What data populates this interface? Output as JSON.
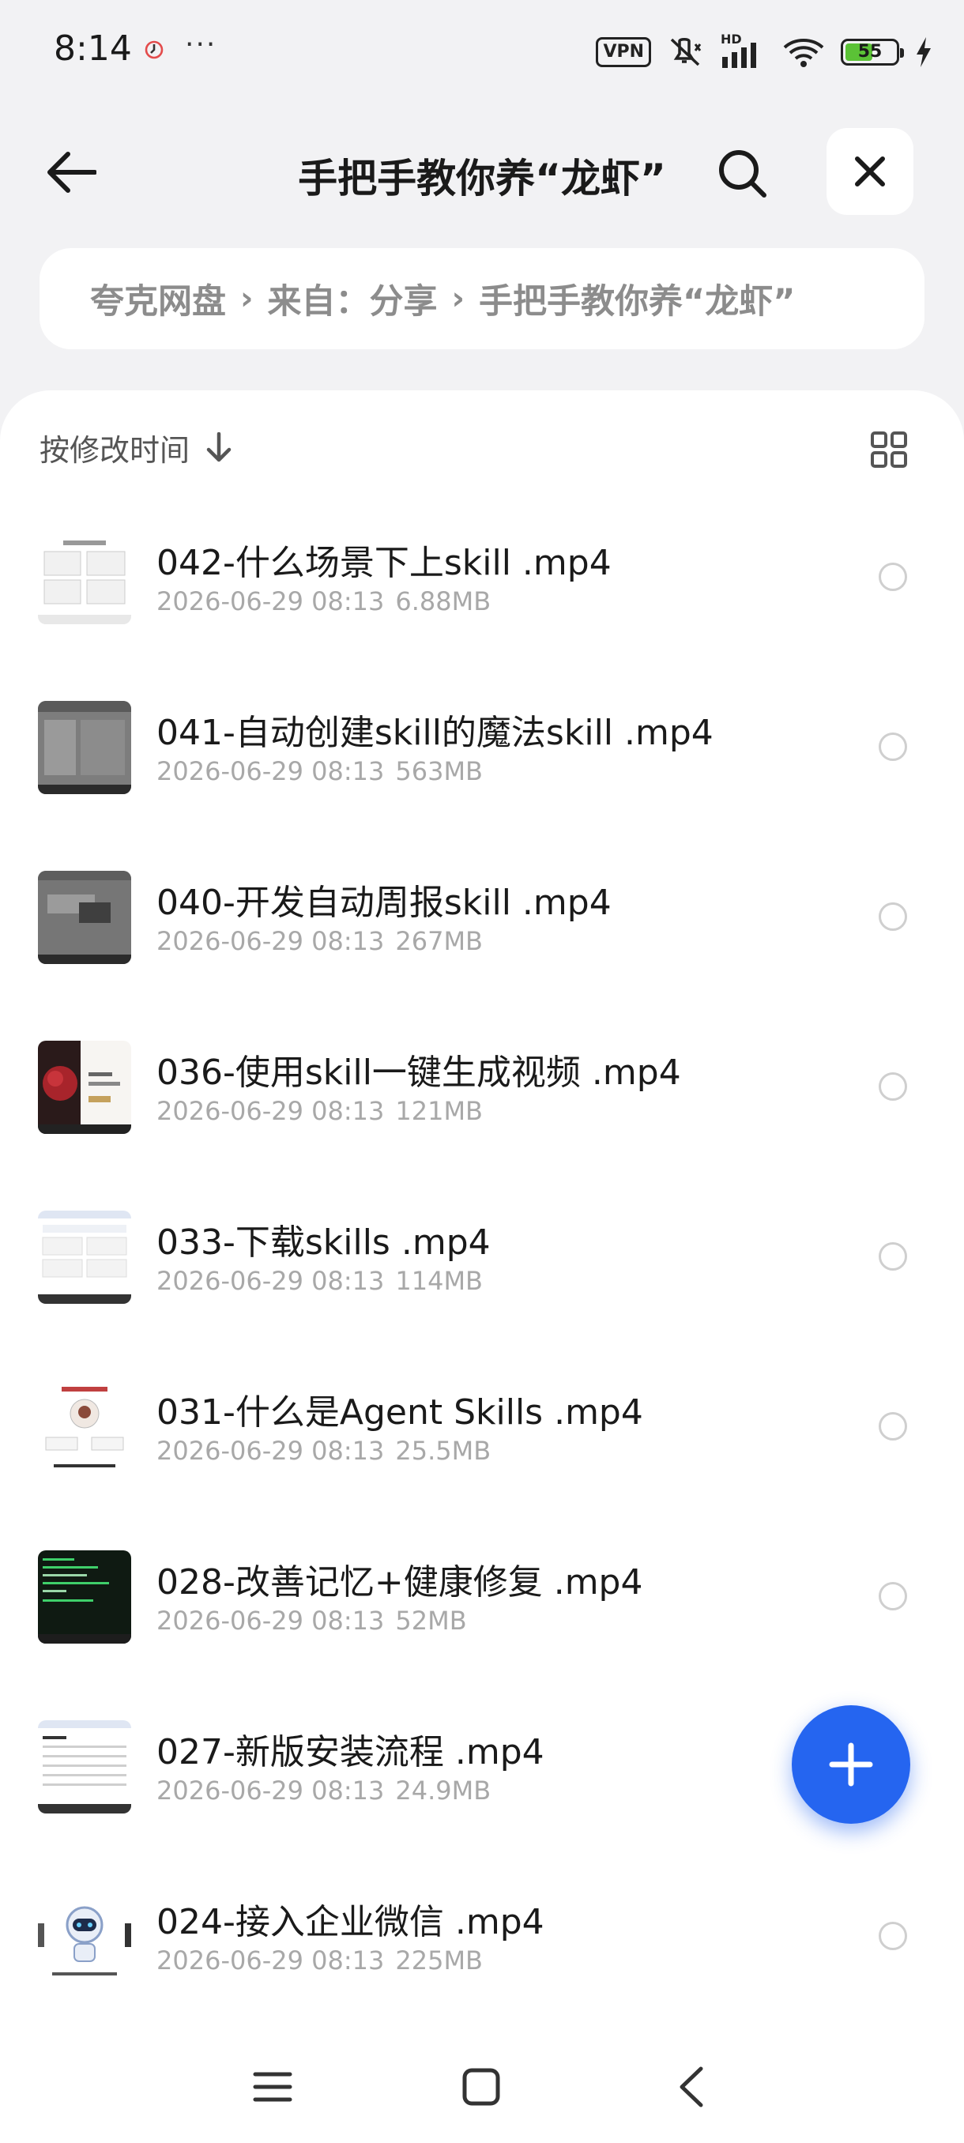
{
  "status_bar": {
    "time": "8:14",
    "more": "···",
    "vpn_label": "VPN",
    "network_label": "HD",
    "battery_level": "55",
    "battery_fraction": 0.55,
    "icons": [
      "dnd-clock-icon",
      "mute-icon",
      "signal-icon",
      "wifi-icon",
      "charging-icon"
    ]
  },
  "header": {
    "title": "手把手教你养“龙虾”",
    "icons": [
      "back-arrow-icon",
      "search-icon",
      "close-icon"
    ]
  },
  "breadcrumb": {
    "items": [
      "夸克网盘",
      "来自：分享",
      "手把手教你养“龙虾”"
    ],
    "separator": "›"
  },
  "sort": {
    "label": "按修改时间",
    "icons": [
      "sort-down-arrow-icon",
      "grid-view-icon"
    ]
  },
  "files": [
    {
      "name": "042-什么场景下上skill .mp4",
      "date": "2026-06-29 08:13",
      "size": "6.88MB",
      "thumb": "light"
    },
    {
      "name": "041-自动创建skill的魔法skill .mp4",
      "date": "2026-06-29 08:13",
      "size": "563MB",
      "thumb": "gray"
    },
    {
      "name": "040-开发自动周报skill .mp4",
      "date": "2026-06-29 08:13",
      "size": "267MB",
      "thumb": "gray2"
    },
    {
      "name": "036-使用skill一键生成视频 .mp4",
      "date": "2026-06-29 08:13",
      "size": "121MB",
      "thumb": "rose"
    },
    {
      "name": "033-下载skills .mp4",
      "date": "2026-06-29 08:13",
      "size": "114MB",
      "thumb": "web"
    },
    {
      "name": "031-什么是Agent Skills .mp4",
      "date": "2026-06-29 08:13",
      "size": "25.5MB",
      "thumb": "skills"
    },
    {
      "name": "028-改善记忆+健康修复 .mp4",
      "date": "2026-06-29 08:13",
      "size": "52MB",
      "thumb": "terminal"
    },
    {
      "name": "027-新版安装流程 .mp4",
      "date": "2026-06-29 08:13",
      "size": "24.9MB",
      "thumb": "table"
    },
    {
      "name": "024-接入企业微信 .mp4",
      "date": "2026-06-29 08:13",
      "size": "225MB",
      "thumb": "robot"
    }
  ],
  "fab": {
    "icon": "plus-icon"
  },
  "nav": {
    "icons": [
      "menu-icon",
      "home-icon",
      "back-icon"
    ]
  },
  "colors": {
    "accent": "#2565f0",
    "battery": "#5bc236",
    "meta_text": "#a8a8a8"
  }
}
